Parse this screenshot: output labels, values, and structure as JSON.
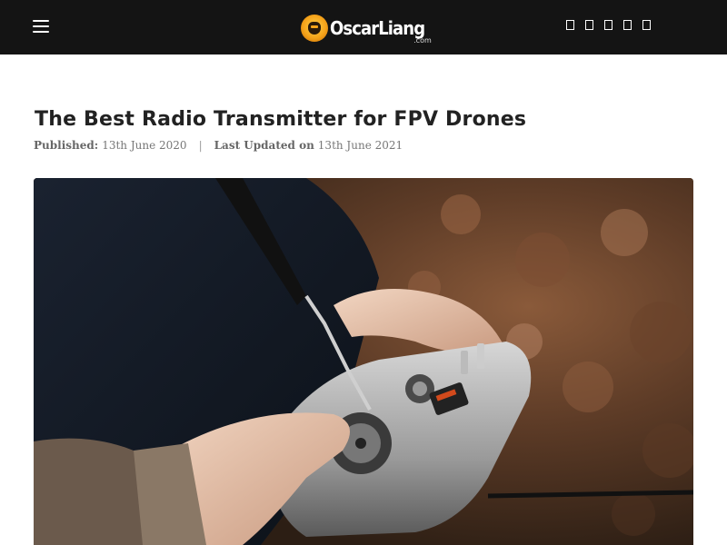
{
  "header": {
    "menu_icon": "hamburger-menu-icon",
    "logo": {
      "brand": "OscarLiang",
      "domain": ".com"
    },
    "social_icons": [
      "social-icon-1",
      "social-icon-2",
      "social-icon-3",
      "social-icon-4",
      "social-icon-5"
    ]
  },
  "article": {
    "title": "The Best Radio Transmitter for FPV Drones",
    "published_label": "Published:",
    "published_date": "13th June 2020",
    "separator": "|",
    "updated_label": "Last Updated on",
    "updated_date": "13th June 2021",
    "hero_image": "photo of hands holding a silver FrSky radio transmitter"
  },
  "colors": {
    "header_bg": "#141414",
    "title_text": "#222222",
    "meta_text": "#777777"
  }
}
